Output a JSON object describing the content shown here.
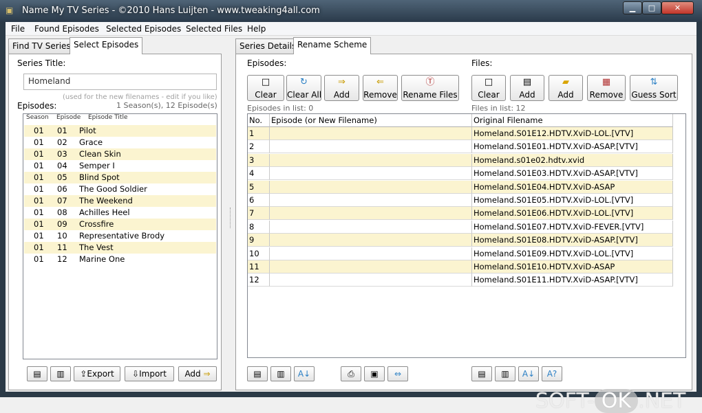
{
  "window": {
    "title": "Name My TV Series - ©2010 Hans Luijten - www.tweaking4all.com"
  },
  "menu": [
    "File",
    "Found Episodes",
    "Selected Episodes",
    "Selected Files",
    "Help"
  ],
  "left_tabs": [
    "Find TV Series",
    "Select Episodes"
  ],
  "right_tabs": [
    "Series Details",
    "Rename Scheme"
  ],
  "left": {
    "series_title_label": "Series Title:",
    "series_title_value": "Homeland",
    "filename_hint": "(used for the new filenames - edit if you like)",
    "episodes_label": "Episodes:",
    "episodes_count": "1 Season(s), 12 Episode(s)",
    "list_headers": [
      "Season",
      "Episode",
      "Episode Title"
    ],
    "episodes": [
      {
        "season": "01",
        "episode": "01",
        "title": "Pilot"
      },
      {
        "season": "01",
        "episode": "02",
        "title": "Grace"
      },
      {
        "season": "01",
        "episode": "03",
        "title": "Clean Skin"
      },
      {
        "season": "01",
        "episode": "04",
        "title": "Semper I"
      },
      {
        "season": "01",
        "episode": "05",
        "title": "Blind Spot"
      },
      {
        "season": "01",
        "episode": "06",
        "title": "The Good Soldier"
      },
      {
        "season": "01",
        "episode": "07",
        "title": "The Weekend"
      },
      {
        "season": "01",
        "episode": "08",
        "title": "Achilles Heel"
      },
      {
        "season": "01",
        "episode": "09",
        "title": "Crossfire"
      },
      {
        "season": "01",
        "episode": "10",
        "title": "Representative Brody"
      },
      {
        "season": "01",
        "episode": "11",
        "title": "The Vest"
      },
      {
        "season": "01",
        "episode": "12",
        "title": "Marine One"
      }
    ],
    "export_label": "Export",
    "import_label": "Import",
    "add_label": "Add"
  },
  "right": {
    "episodes_label": "Episodes:",
    "files_label": "Files:",
    "episode_buttons": [
      "Clear",
      "Clear All",
      "Add",
      "Remove",
      "Rename Files"
    ],
    "file_buttons": [
      "Clear",
      "Add",
      "Add",
      "Remove",
      "Guess Sort"
    ],
    "episodes_in_list": "Episodes in list: 0",
    "files_in_list": "Files in list: 12",
    "grid_headers": [
      "No.",
      "Episode (or New Filename)",
      "Original Filename"
    ],
    "rows": [
      {
        "no": "1",
        "episode": "",
        "original": "Homeland.S01E12.HDTV.XviD-LOL.[VTV]"
      },
      {
        "no": "2",
        "episode": "",
        "original": "Homeland.S01E01.HDTV.XviD-ASAP.[VTV]"
      },
      {
        "no": "3",
        "episode": "",
        "original": "Homeland.s01e02.hdtv.xvid"
      },
      {
        "no": "4",
        "episode": "",
        "original": "Homeland.S01E03.HDTV.XviD-ASAP.[VTV]"
      },
      {
        "no": "5",
        "episode": "",
        "original": "Homeland.S01E04.HDTV.XviD-ASAP"
      },
      {
        "no": "6",
        "episode": "",
        "original": "Homeland.S01E05.HDTV.XviD-LOL.[VTV]"
      },
      {
        "no": "7",
        "episode": "",
        "original": "Homeland.S01E06.HDTV.XviD-LOL.[VTV]"
      },
      {
        "no": "8",
        "episode": "",
        "original": "Homeland.S01E07.HDTV.XviD-FEVER.[VTV]"
      },
      {
        "no": "9",
        "episode": "",
        "original": "Homeland.S01E08.HDTV.XviD-ASAP.[VTV]"
      },
      {
        "no": "10",
        "episode": "",
        "original": "Homeland.S01E09.HDTV.XviD-LOL.[VTV]"
      },
      {
        "no": "11",
        "episode": "",
        "original": "Homeland.S01E10.HDTV.XviD-ASAP"
      },
      {
        "no": "12",
        "episode": "",
        "original": "Homeland.S01E11.HDTV.XviD-ASAP.[VTV]"
      }
    ]
  },
  "watermark": {
    "left": "SOFT-",
    "ok": "OK",
    "right": ".NET"
  },
  "colors": {
    "row_highlight": "#fbf4d0",
    "titlebar": "#2a3a4a"
  }
}
